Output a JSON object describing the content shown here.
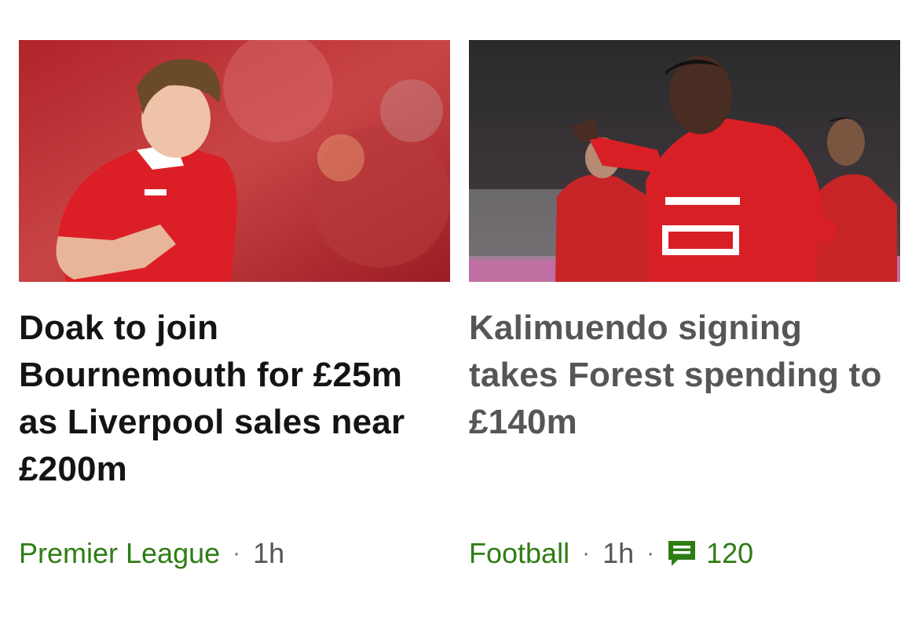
{
  "cards": [
    {
      "image_icon": "photo-liverpool-player",
      "headline": "Doak to join Bournemouth for £25m as Liverpool sales near £200m",
      "section": "Premier League",
      "separator": "·",
      "time": "1h"
    },
    {
      "image_icon": "photo-rennes-player",
      "headline": "Kalimuendo signing takes Forest spending to £140m",
      "section": "Football",
      "separator": "·",
      "time": "1h",
      "separator2": "·",
      "comments_icon": "comment-icon",
      "comments_count": "120"
    }
  ],
  "colors": {
    "headline": "#141414",
    "headline_visited": "#545658",
    "section_link": "#2e7d14",
    "meta_text": "#545658"
  }
}
